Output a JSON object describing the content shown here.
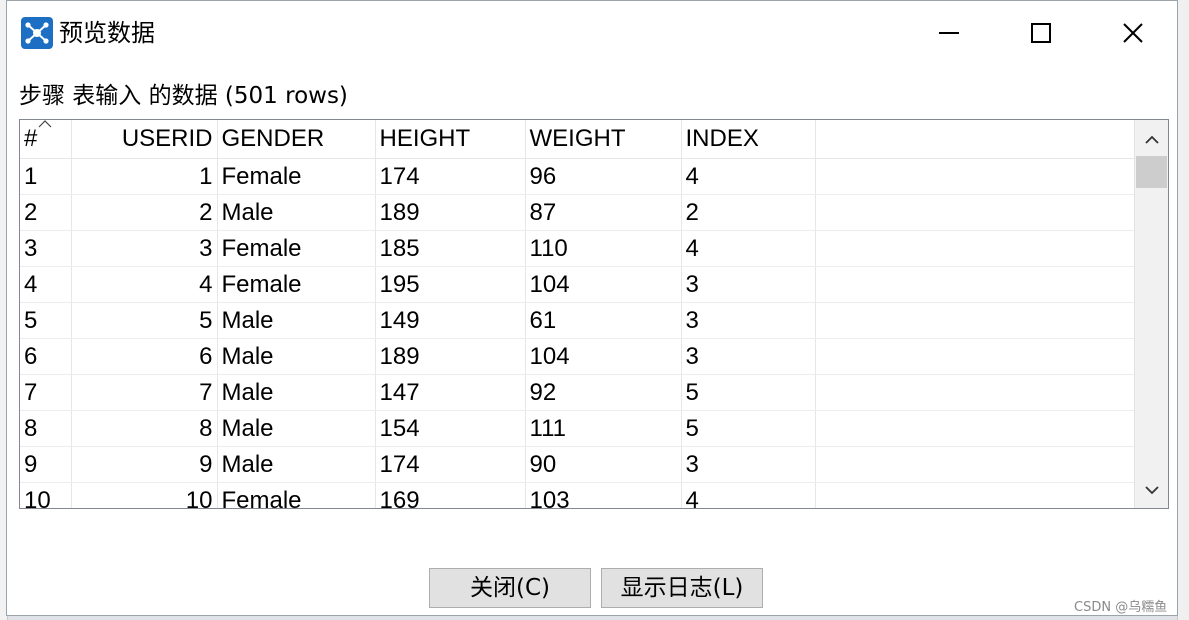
{
  "window": {
    "title": "预览数据",
    "icon": "network-nodes-icon"
  },
  "step_label": "步骤 表输入 的数据  (501 rows)",
  "table": {
    "columns": [
      "#",
      "USERID",
      "GENDER",
      "HEIGHT",
      "WEIGHT",
      "INDEX"
    ],
    "rows": [
      [
        "1",
        "1",
        "Female",
        "174",
        "96",
        "4"
      ],
      [
        "2",
        "2",
        "Male",
        "189",
        "87",
        "2"
      ],
      [
        "3",
        "3",
        "Female",
        "185",
        "110",
        "4"
      ],
      [
        "4",
        "4",
        "Female",
        "195",
        "104",
        "3"
      ],
      [
        "5",
        "5",
        "Male",
        "149",
        "61",
        "3"
      ],
      [
        "6",
        "6",
        "Male",
        "189",
        "104",
        "3"
      ],
      [
        "7",
        "7",
        "Male",
        "147",
        "92",
        "5"
      ],
      [
        "8",
        "8",
        "Male",
        "154",
        "111",
        "5"
      ],
      [
        "9",
        "9",
        "Male",
        "174",
        "90",
        "3"
      ],
      [
        "10",
        "10",
        "Female",
        "169",
        "103",
        "4"
      ]
    ]
  },
  "buttons": {
    "close_label": "关闭(C)",
    "log_label": "显示日志(L)"
  },
  "watermark": "CSDN @乌糯鱼",
  "colors": {
    "icon_bg": "#1c6fc2",
    "button_bg": "#e1e1e1",
    "scroll_thumb": "#cdcdcd"
  }
}
